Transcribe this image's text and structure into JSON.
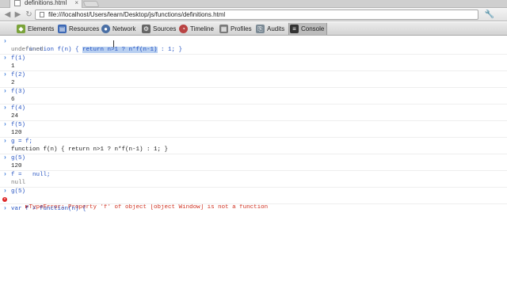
{
  "browser": {
    "tab_title": "definitions.html",
    "tab_close": "×",
    "url": "file:///localhost/Users/learn/Desktop/js/functions/definitions.html",
    "back_glyph": "◀",
    "forward_glyph": "▶",
    "reload_glyph": "↻",
    "wrench_glyph": "🔧"
  },
  "devtools": {
    "tabs": [
      {
        "label": "Elements",
        "icon": "elements-icon",
        "color": "#7aa33a"
      },
      {
        "label": "Resources",
        "icon": "resources-icon",
        "color": "#3c68b4"
      },
      {
        "label": "Network",
        "icon": "network-icon",
        "color": "#4a6fa5"
      },
      {
        "label": "Sources",
        "icon": "sources-icon",
        "color": "#666666"
      },
      {
        "label": "Timeline",
        "icon": "timeline-icon",
        "color": "#b94343"
      },
      {
        "label": "Profiles",
        "icon": "profiles-icon",
        "color": "#7a7a7a"
      },
      {
        "label": "Audits",
        "icon": "audits-icon",
        "color": "#7b8a95"
      },
      {
        "label": "Console",
        "icon": "console-icon",
        "color": "#333333"
      }
    ],
    "active_tab": "Console"
  },
  "console": {
    "l0_pre": "function f(n) { ",
    "l0_hl": "return n>1 ? n*f(n-1)",
    "l0_post": " : 1; }",
    "l1": "undefined",
    "l2": "f(1)",
    "l3": "1",
    "l4": "f(2)",
    "l5": "2",
    "l6": "f(3)",
    "l7": "6",
    "l8": "f(4)",
    "l9": "24",
    "l10": "f(5)",
    "l11": "120",
    "l12": "g = f;",
    "l13": "function f(n) { return n>1 ? n*f(n-1) : 1; }",
    "l14": "g(5)",
    "l15": "120",
    "l16": "f =   null;",
    "l17": "null",
    "l18": "g(5)",
    "l19": "▶TypeError: Property 'f' of object [object Window] is not a function",
    "l20": "var f = function(n) {"
  }
}
